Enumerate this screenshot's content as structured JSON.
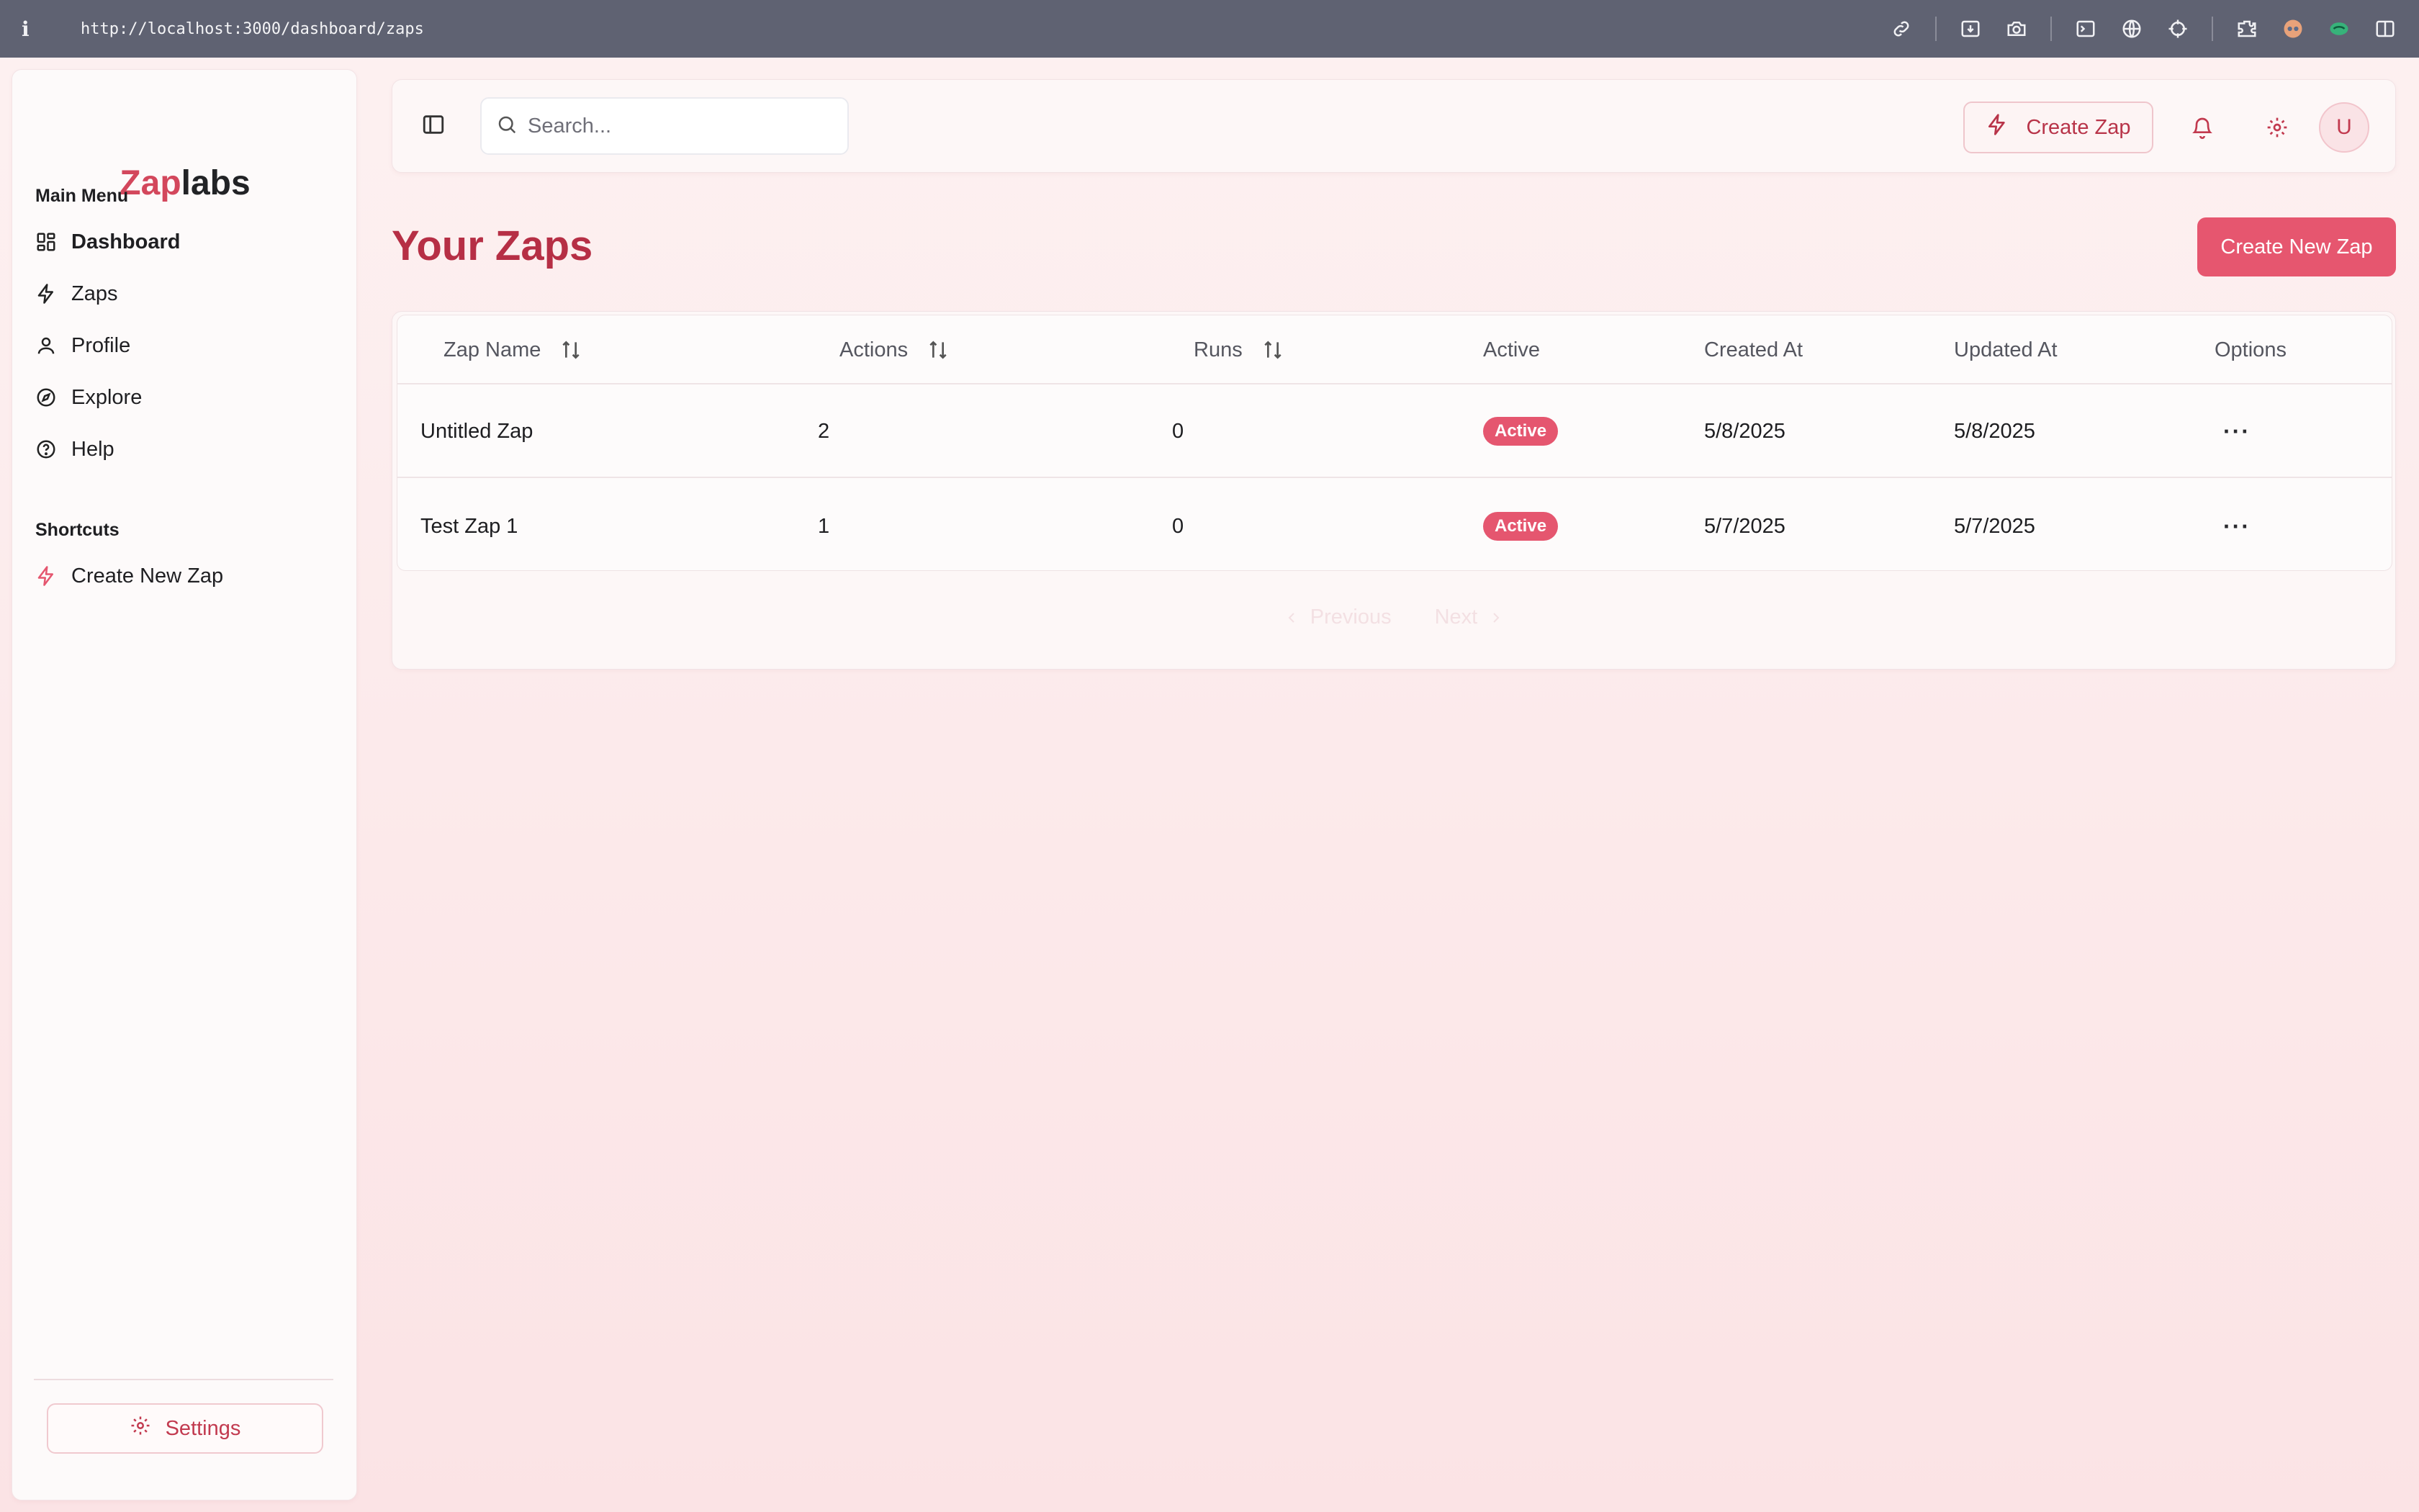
{
  "browser": {
    "info_glyph": "i",
    "url": "http://localhost:3000/dashboard/zaps",
    "toolbar_icons": [
      "link-icon",
      "download-icon",
      "camera-icon",
      "terminal-icon",
      "globe-icon",
      "crosshair-icon",
      "extensions-icon",
      "incognito-icon",
      "shield-icon",
      "split-view-icon"
    ]
  },
  "sidebar": {
    "logo_part1": "Zap",
    "logo_part2": "labs",
    "main_menu_title": "Main Menu",
    "items": [
      {
        "label": "Dashboard",
        "icon": "dashboard-icon",
        "active": true
      },
      {
        "label": "Zaps",
        "icon": "zap-icon"
      },
      {
        "label": "Profile",
        "icon": "user-icon"
      },
      {
        "label": "Explore",
        "icon": "compass-icon"
      },
      {
        "label": "Help",
        "icon": "help-icon"
      }
    ],
    "shortcuts_title": "Shortcuts",
    "shortcut_item": {
      "label": "Create New Zap",
      "icon": "zap-icon"
    },
    "settings_label": "Settings"
  },
  "header": {
    "search_placeholder": "Search...",
    "create_zap_label": "Create Zap",
    "avatar_initial": "U"
  },
  "page": {
    "title": "Your Zaps",
    "create_new_label": "Create New Zap"
  },
  "table": {
    "headers": {
      "name": "Zap Name",
      "actions": "Actions",
      "runs": "Runs",
      "active": "Active",
      "created": "Created At",
      "updated": "Updated At",
      "options": "Options"
    },
    "rows": [
      {
        "name": "Untitled Zap",
        "actions": "2",
        "runs": "0",
        "status": "Active",
        "created": "5/8/2025",
        "updated": "5/8/2025",
        "options": "···"
      },
      {
        "name": "Test Zap 1",
        "actions": "1",
        "runs": "0",
        "status": "Active",
        "created": "5/7/2025",
        "updated": "5/7/2025",
        "options": "···"
      }
    ],
    "pagination": {
      "previous": "Previous",
      "next": "Next"
    }
  },
  "colors": {
    "accent": "#e5566f",
    "title": "#b62f45",
    "browser_bar": "#5f6272"
  }
}
